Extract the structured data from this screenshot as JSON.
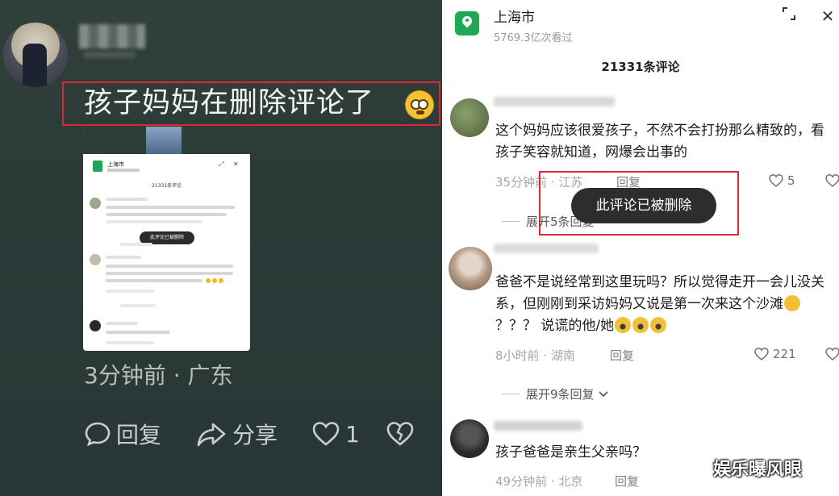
{
  "left": {
    "comment": "孩子妈妈在删除评论了",
    "meta": "3分钟前 · 广东",
    "actions": {
      "reply": "回复",
      "share": "分享",
      "like_count": "1"
    },
    "thumbnail": {
      "title": "上海市",
      "toast": "此评论已被删除",
      "count": "21331条评论"
    }
  },
  "right": {
    "title": "上海市",
    "views": "5769.3亿次看过",
    "comment_count": "21331条评论",
    "toast": "此评论已被删除",
    "comments": [
      {
        "text": "这个妈妈应该很爱孩子，不然不会打扮那么精致的，看孩子笑容就知道，网爆会出事的",
        "time": "35分钟前 · 江苏",
        "reply": "回复",
        "likes": "5",
        "expand": "展开5条回复"
      },
      {
        "text_a": "爸爸不是说经常到这里玩吗？所以觉得走开一会儿没关系，但刚刚到采访妈妈又说是第一次来这个沙滩",
        "text_b": "？？？ 说谎的他/她",
        "time": "8小时前 · 湖南",
        "reply": "回复",
        "likes": "221",
        "expand": "展开9条回复"
      },
      {
        "text": "孩子爸爸是亲生父亲吗？",
        "time": "49分钟前 · 北京",
        "reply": "回复"
      }
    ]
  },
  "watermark": "娱乐曝风眼",
  "colors": {
    "highlight_red": "#e0262e",
    "location_green": "#1fa955",
    "left_bg": "#2c3a38"
  }
}
